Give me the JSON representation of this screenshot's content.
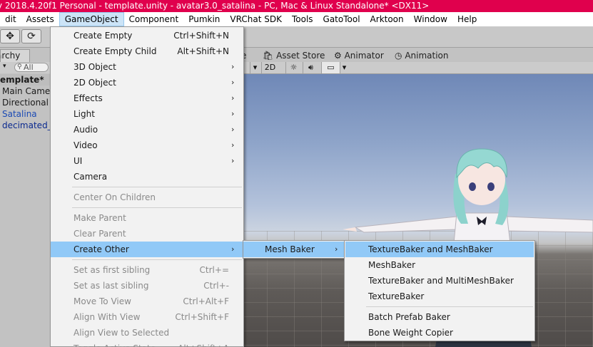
{
  "window": {
    "title": "y 2018.4.20f1 Personal - template.unity - avatar3.0_satalina - PC, Mac & Linux Standalone* <DX11>"
  },
  "menubar": {
    "items": [
      "dit",
      "Assets",
      "GameObject",
      "Component",
      "Pumkin",
      "VRChat SDK",
      "Tools",
      "GatoTool",
      "Arktoon",
      "Window",
      "Help"
    ],
    "active": "GameObject"
  },
  "hierarchy": {
    "tab_label": "archy",
    "search_placeholder": "All",
    "scene_name": "emplate*",
    "rows": [
      "Main Came",
      "Directional",
      "Satalina",
      "decimated_"
    ]
  },
  "scene": {
    "tabs": [
      "e",
      "Asset Store",
      "Animator",
      "Animation"
    ],
    "toolbar": {
      "mode_2d": "2D"
    }
  },
  "gameobject_menu": {
    "items": [
      {
        "label": "Create Empty",
        "shortcut": "Ctrl+Shift+N",
        "submenu": false,
        "enabled": true
      },
      {
        "label": "Create Empty Child",
        "shortcut": "Alt+Shift+N",
        "submenu": false,
        "enabled": true
      },
      {
        "label": "3D Object",
        "shortcut": "",
        "submenu": true,
        "enabled": true
      },
      {
        "label": "2D Object",
        "shortcut": "",
        "submenu": true,
        "enabled": true
      },
      {
        "label": "Effects",
        "shortcut": "",
        "submenu": true,
        "enabled": true
      },
      {
        "label": "Light",
        "shortcut": "",
        "submenu": true,
        "enabled": true
      },
      {
        "label": "Audio",
        "shortcut": "",
        "submenu": true,
        "enabled": true
      },
      {
        "label": "Video",
        "shortcut": "",
        "submenu": true,
        "enabled": true
      },
      {
        "label": "UI",
        "shortcut": "",
        "submenu": true,
        "enabled": true
      },
      {
        "label": "Camera",
        "shortcut": "",
        "submenu": false,
        "enabled": true
      },
      {
        "label": "Center On Children",
        "shortcut": "",
        "submenu": false,
        "enabled": false
      },
      {
        "label": "Make Parent",
        "shortcut": "",
        "submenu": false,
        "enabled": false
      },
      {
        "label": "Clear Parent",
        "shortcut": "",
        "submenu": false,
        "enabled": false
      },
      {
        "label": "Create Other",
        "shortcut": "",
        "submenu": true,
        "enabled": true,
        "highlighted": true
      },
      {
        "label": "Set as first sibling",
        "shortcut": "Ctrl+=",
        "submenu": false,
        "enabled": false
      },
      {
        "label": "Set as last sibling",
        "shortcut": "Ctrl+-",
        "submenu": false,
        "enabled": false
      },
      {
        "label": "Move To View",
        "shortcut": "Ctrl+Alt+F",
        "submenu": false,
        "enabled": false
      },
      {
        "label": "Align With View",
        "shortcut": "Ctrl+Shift+F",
        "submenu": false,
        "enabled": false
      },
      {
        "label": "Align View to Selected",
        "shortcut": "",
        "submenu": false,
        "enabled": false
      },
      {
        "label": "Toggle Active State",
        "shortcut": "Alt+Shift+A",
        "submenu": false,
        "enabled": false
      }
    ]
  },
  "create_other_menu": {
    "items": [
      {
        "label": "Mesh Baker",
        "submenu": true,
        "highlighted": true
      }
    ]
  },
  "mesh_baker_menu": {
    "items": [
      {
        "label": "TextureBaker and MeshBaker",
        "highlighted": true
      },
      {
        "label": "MeshBaker",
        "highlighted": false
      },
      {
        "label": "TextureBaker and MultiMeshBaker",
        "highlighted": false
      },
      {
        "label": "TextureBaker",
        "highlighted": false
      },
      {
        "label": "Batch Prefab Baker",
        "highlighted": false
      },
      {
        "label": "Bone Weight Copier",
        "highlighted": false
      }
    ]
  },
  "colors": {
    "title_bar": "#e0004d",
    "menu_highlight": "#91c9f7"
  }
}
